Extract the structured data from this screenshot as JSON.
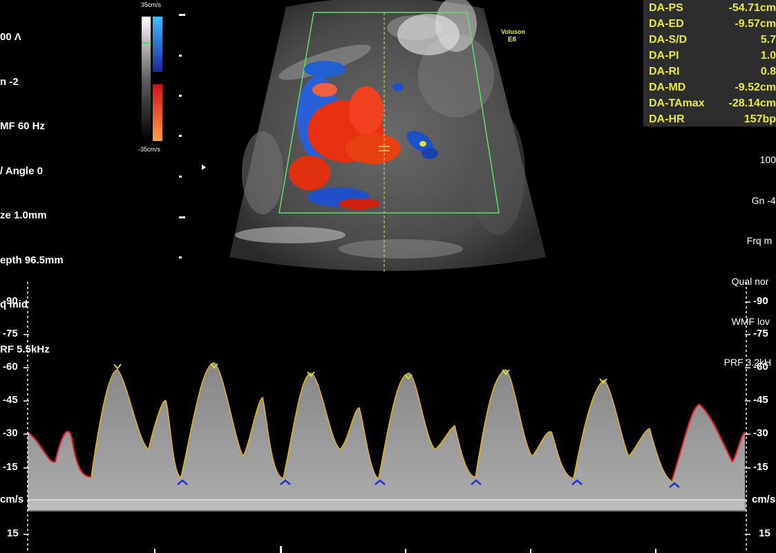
{
  "left_info": [
    "00 Ʌ",
    "n -2",
    "MF 60 Hz",
    "/ Angle 0",
    "ze 1.0mm",
    "epth 96.5mm",
    "q mid",
    "RF 5.5kHz"
  ],
  "color_bar": {
    "top_label": "35cm/s",
    "bottom_label": "-35cm/s"
  },
  "brand": {
    "line1": "Voluson",
    "line2": "E8"
  },
  "measurements": [
    {
      "label": "DA-PS",
      "value": "-54.71cm"
    },
    {
      "label": "DA-ED",
      "value": "-9.57cm"
    },
    {
      "label": "DA-S/D",
      "value": "5.7"
    },
    {
      "label": "DA-PI",
      "value": "1.0"
    },
    {
      "label": "DA-RI",
      "value": "0.8"
    },
    {
      "label": "DA-MD",
      "value": "-9.52cm"
    },
    {
      "label": "DA-TAmax",
      "value": "-28.14cm"
    },
    {
      "label": "DA-HR",
      "value": "157bp"
    }
  ],
  "right_info": [
    "100",
    "Gn -4",
    "Frq m",
    "Qual nor",
    "WMF lov",
    "PRF 3.2kH"
  ],
  "spectrum_scale": {
    "ticks": [
      "-90",
      "-75",
      "-60",
      "-45",
      "-30",
      "-15",
      "cm/s",
      "15"
    ]
  },
  "colors": {
    "measure_text": "#e9ea3a",
    "sector_outline": "#5fe06a",
    "trace_yellow": "#e0b020",
    "trace_red": "#e0202a",
    "marker_blue": "#2233cc"
  }
}
